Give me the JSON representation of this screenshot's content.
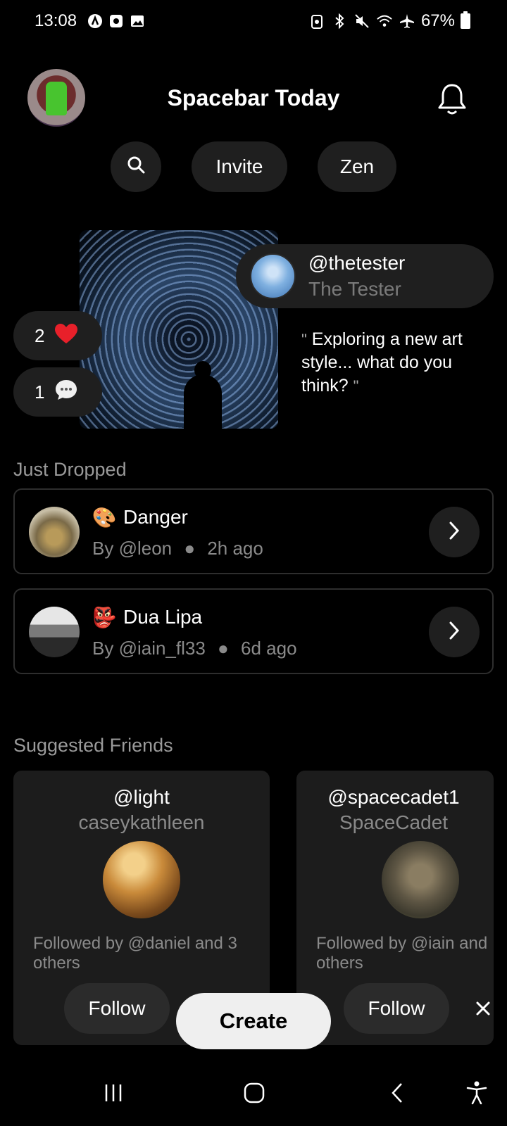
{
  "status_bar": {
    "time": "13:08",
    "battery": "67%",
    "left_icons": [
      "a-icon",
      "app-icon",
      "gallery-icon"
    ],
    "right_icons": [
      "battery-saver-icon",
      "bluetooth-icon",
      "mute-icon",
      "wifi-icon",
      "airplane-icon"
    ]
  },
  "header": {
    "title": "Spacebar Today",
    "bell_icon": "bell-icon"
  },
  "pills": {
    "search_icon": "search-icon",
    "invite": "Invite",
    "zen": "Zen"
  },
  "featured": {
    "handle": "@thetester",
    "name": "The Tester",
    "quote": "Exploring a new art style... what do you think?",
    "quote_open": "\"",
    "quote_close": "\"",
    "likes": "2",
    "comments": "1"
  },
  "just_dropped": {
    "title": "Just Dropped",
    "items": [
      {
        "emoji": "🎨",
        "title": "Danger",
        "by": "By @leon",
        "time": "2h ago"
      },
      {
        "emoji": "👺",
        "title": "Dua Lipa",
        "by": "By @iain_fl33",
        "time": "6d ago"
      }
    ]
  },
  "suggested_friends": {
    "title": "Suggested Friends",
    "items": [
      {
        "handle": "@light",
        "name": "caseykathleen",
        "followed": "Followed by @daniel and 3 others",
        "follow": "Follow"
      },
      {
        "handle": "@spacecadet1",
        "name": "SpaceCadet",
        "followed": "Followed by @iain and others",
        "follow": "Follow"
      }
    ]
  },
  "create_label": "Create",
  "colors": {
    "background": "#000000",
    "surface": "#1f1f1f",
    "heart": "#e8202a",
    "muted": "#8a8a8a"
  }
}
